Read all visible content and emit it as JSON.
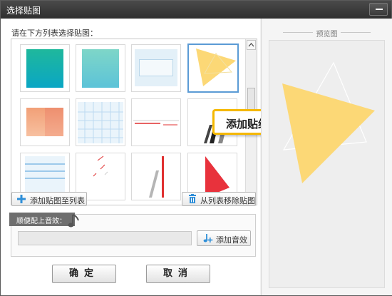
{
  "window": {
    "title": "选择贴图",
    "close_icon": "minus-close-icon"
  },
  "list": {
    "label": "请在下方列表选择贴图：",
    "tooltip": "添加贴纸",
    "thumbnails": [
      {
        "name": "teal-gradient"
      },
      {
        "name": "mint-gradient"
      },
      {
        "name": "light-blue-frame"
      },
      {
        "name": "yellow-triangle",
        "selected": true
      },
      {
        "name": "orange-gradient"
      },
      {
        "name": "blue-grid"
      },
      {
        "name": "red-lines"
      },
      {
        "name": "black-stripes"
      },
      {
        "name": "blue-stripes"
      },
      {
        "name": "red-dashes"
      },
      {
        "name": "gray-red-bars"
      },
      {
        "name": "red-triangle"
      }
    ]
  },
  "buttons": {
    "add_to_list": "添加贴图至列表",
    "remove_from_list": "从列表移除贴图",
    "add_sound": "添加音效",
    "ok": "确定",
    "cancel": "取消"
  },
  "sound": {
    "label": "顺便配上音效：",
    "value": ""
  },
  "preview": {
    "label": "预览图"
  },
  "colors": {
    "accent_yellow": "#f5b800",
    "triangle_yellow": "#fcd876",
    "selection_blue": "#5b9bd5"
  }
}
